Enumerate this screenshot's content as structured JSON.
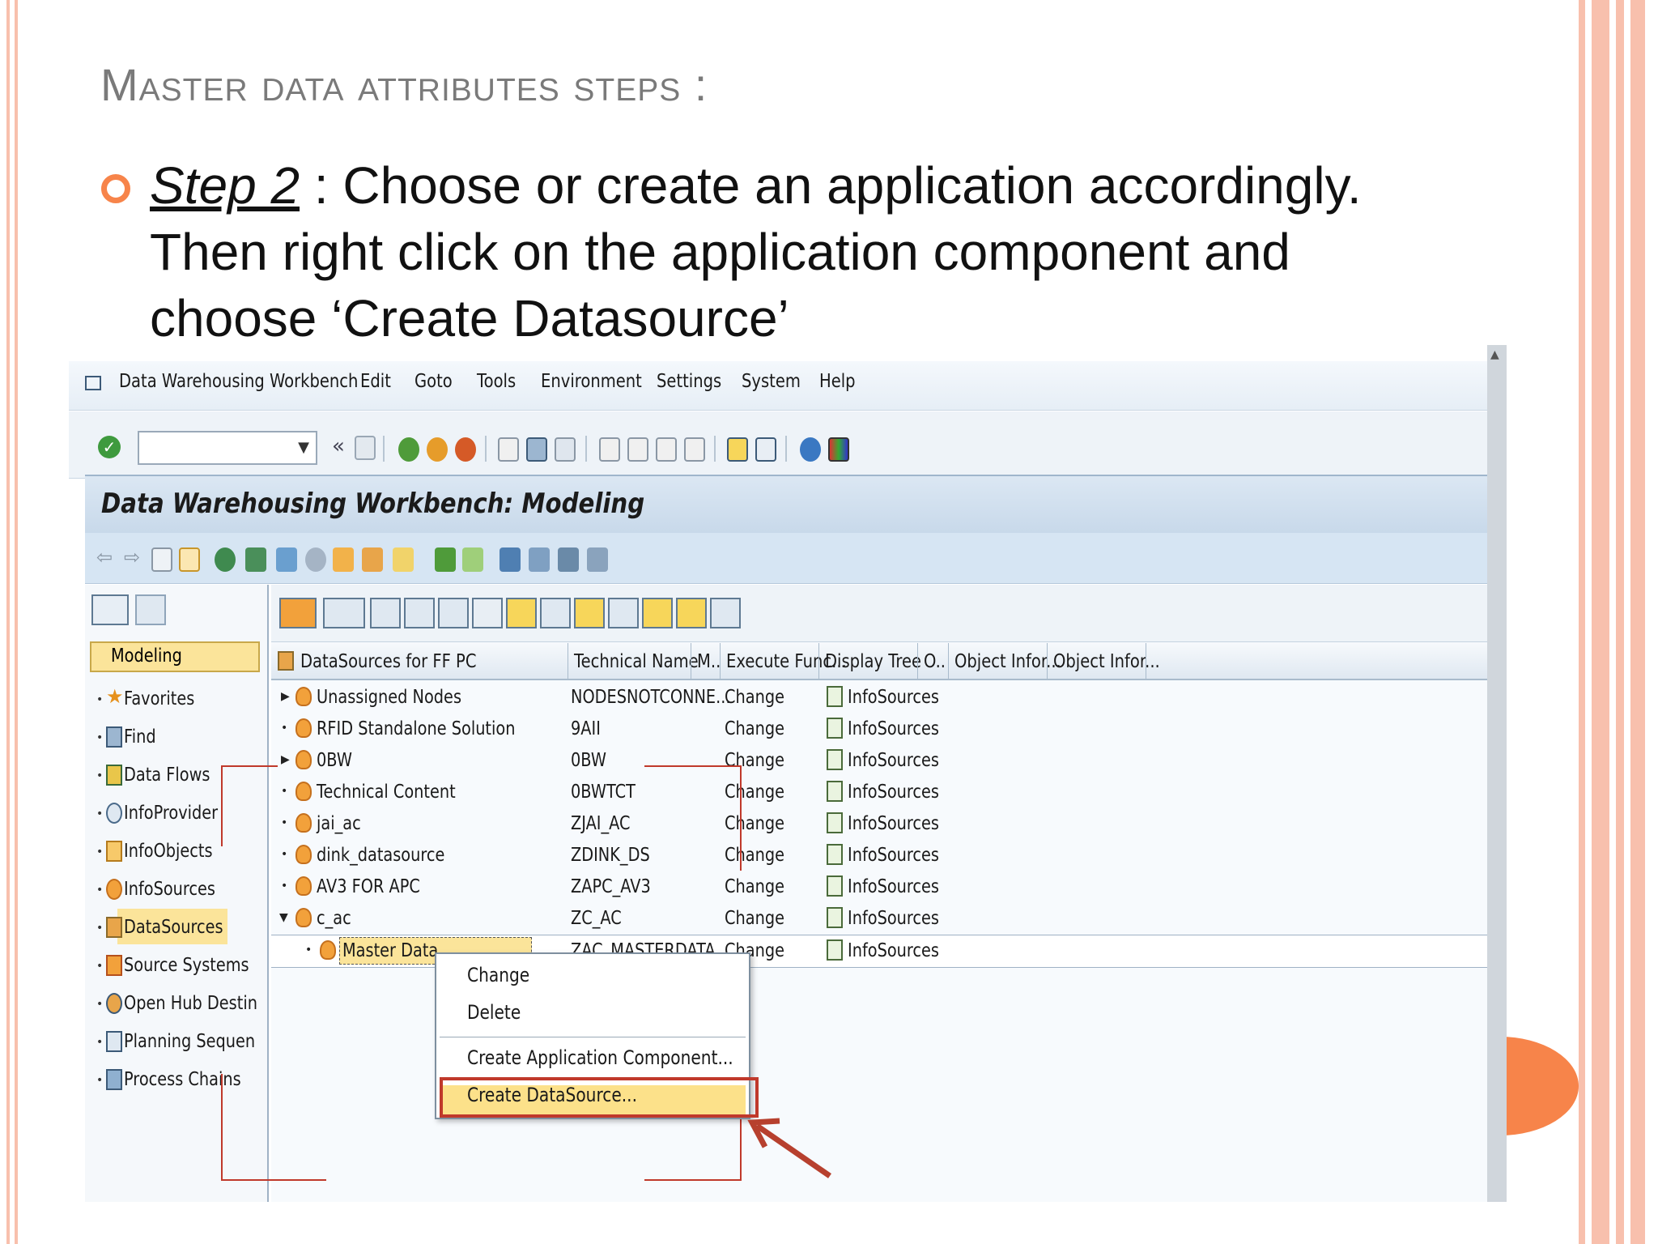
{
  "slide": {
    "title": "Master data attributes steps :",
    "step_label": "Step 2",
    "step_text": " : Choose or create an application accordingly. Then right click on the application component and choose ‘Create Datasource’",
    "accent_color": "#f7844a",
    "stripe_color": "#f8c0ad"
  },
  "menubar": {
    "app_icon": "exit-icon",
    "items": [
      "Data Warehousing Workbench",
      "Edit",
      "Goto",
      "Tools",
      "Environment",
      "Settings",
      "System",
      "Help"
    ]
  },
  "toolbar": {
    "command_value": "",
    "icons": [
      "enter-check-icon",
      "back-arrows-icon",
      "save-icon",
      "back-icon",
      "exit-icon",
      "cancel-icon",
      "print-icon",
      "find-icon",
      "find-next-icon",
      "first-page-icon",
      "previous-page-icon",
      "next-page-icon",
      "last-page-icon",
      "new-session-icon",
      "shortcut-icon",
      "help-icon",
      "layout-icon"
    ]
  },
  "panel": {
    "title": "Data Warehousing Workbench: Modeling"
  },
  "nav": {
    "section_button": "Modeling",
    "items": [
      {
        "label": "Favorites",
        "icon": "star-icon"
      },
      {
        "label": "Find",
        "icon": "binoculars-icon"
      },
      {
        "label": "Data Flows",
        "icon": "dataflow-icon"
      },
      {
        "label": "InfoProvider",
        "icon": "infoprovider-icon"
      },
      {
        "label": "InfoObjects",
        "icon": "infoobject-icon"
      },
      {
        "label": "InfoSources",
        "icon": "infosource-icon"
      },
      {
        "label": "DataSources",
        "icon": "datasource-icon"
      },
      {
        "label": "Source Systems",
        "icon": "source-system-icon"
      },
      {
        "label": "Open Hub Destin",
        "icon": "open-hub-icon"
      },
      {
        "label": "Planning Sequen",
        "icon": "planning-icon"
      },
      {
        "label": "Process Chains",
        "icon": "process-chain-icon"
      }
    ],
    "selected": "DataSources"
  },
  "grid": {
    "columns": [
      "DataSources for FF PC",
      "Technical Name",
      "M..",
      "Execute Func...",
      "Display Tree",
      "O..",
      "Object Infor...",
      "Object Infor..."
    ],
    "rows": [
      {
        "name": "Unassigned Nodes",
        "tech": "NODESNOTCONNE...",
        "exec": "Change",
        "tree": "InfoSources",
        "expand": "right"
      },
      {
        "name": "RFID Standalone Solution",
        "tech": "9AII",
        "exec": "Change",
        "tree": "InfoSources",
        "expand": "dot"
      },
      {
        "name": "0BW",
        "tech": "0BW",
        "exec": "Change",
        "tree": "InfoSources",
        "expand": "right"
      },
      {
        "name": "Technical Content",
        "tech": "0BWTCT",
        "exec": "Change",
        "tree": "InfoSources",
        "expand": "dot"
      },
      {
        "name": "jai_ac",
        "tech": "ZJAI_AC",
        "exec": "Change",
        "tree": "InfoSources",
        "expand": "dot"
      },
      {
        "name": "dink_datasource",
        "tech": "ZDINK_DS",
        "exec": "Change",
        "tree": "InfoSources",
        "expand": "dot"
      },
      {
        "name": "AV3 FOR APC",
        "tech": "ZAPC_AV3",
        "exec": "Change",
        "tree": "InfoSources",
        "expand": "dot"
      },
      {
        "name": "c_ac",
        "tech": "ZC_AC",
        "exec": "Change",
        "tree": "InfoSources",
        "expand": "down"
      },
      {
        "name": "Master Data",
        "tech": "ZAC_MASTERDATA",
        "exec": "Change",
        "tree": "InfoSources",
        "expand": "dot"
      }
    ]
  },
  "context_menu": {
    "items": [
      "Change",
      "Delete",
      "Create Application Component...",
      "Create DataSource..."
    ],
    "highlighted": "Create DataSource..."
  }
}
